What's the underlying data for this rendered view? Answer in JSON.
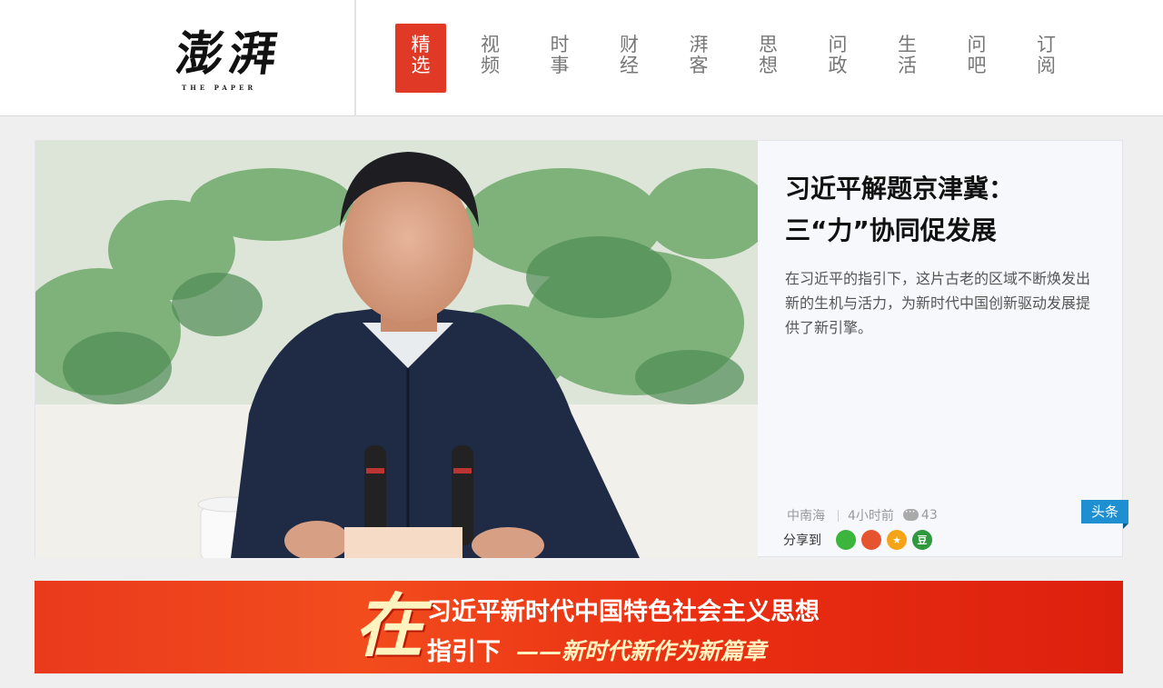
{
  "header": {
    "logo": {
      "main": "澎湃",
      "sub": "THE PAPER"
    },
    "nav": [
      {
        "label": "精选",
        "active": true
      },
      {
        "label": "视频"
      },
      {
        "label": "时事"
      },
      {
        "label": "财经"
      },
      {
        "label": "湃客"
      },
      {
        "label": "思想"
      },
      {
        "label": "问政"
      },
      {
        "label": "生活"
      },
      {
        "label": "问吧"
      },
      {
        "label": "订阅"
      }
    ]
  },
  "hero": {
    "title": "习近平解题京津冀：三“力”协同促发展",
    "summary": "在习近平的指引下，这片古老的区域不断焕发出新的生机与活力，为新时代中国创新驱动发展提供了新引擎。",
    "source": "中南海",
    "time": "4小时前",
    "comments": "43",
    "share_label": "分享到",
    "share_buttons": [
      {
        "name": "wechat",
        "glyph": "",
        "color": "#3bb53b"
      },
      {
        "name": "weibo",
        "glyph": "",
        "color": "#e5532f"
      },
      {
        "name": "qzone",
        "glyph": "★",
        "color": "#f6a417"
      },
      {
        "name": "douban",
        "glyph": "豆",
        "color": "#2e9a3d"
      }
    ],
    "badge": "头条"
  },
  "banner": {
    "char": "在",
    "line1": "习近平新时代中国特色社会主义思想",
    "line2": "指引下",
    "line3": "——新时代新作为新篇章"
  },
  "colors": {
    "accent": "#e03a26",
    "badge": "#1e8fd0"
  }
}
